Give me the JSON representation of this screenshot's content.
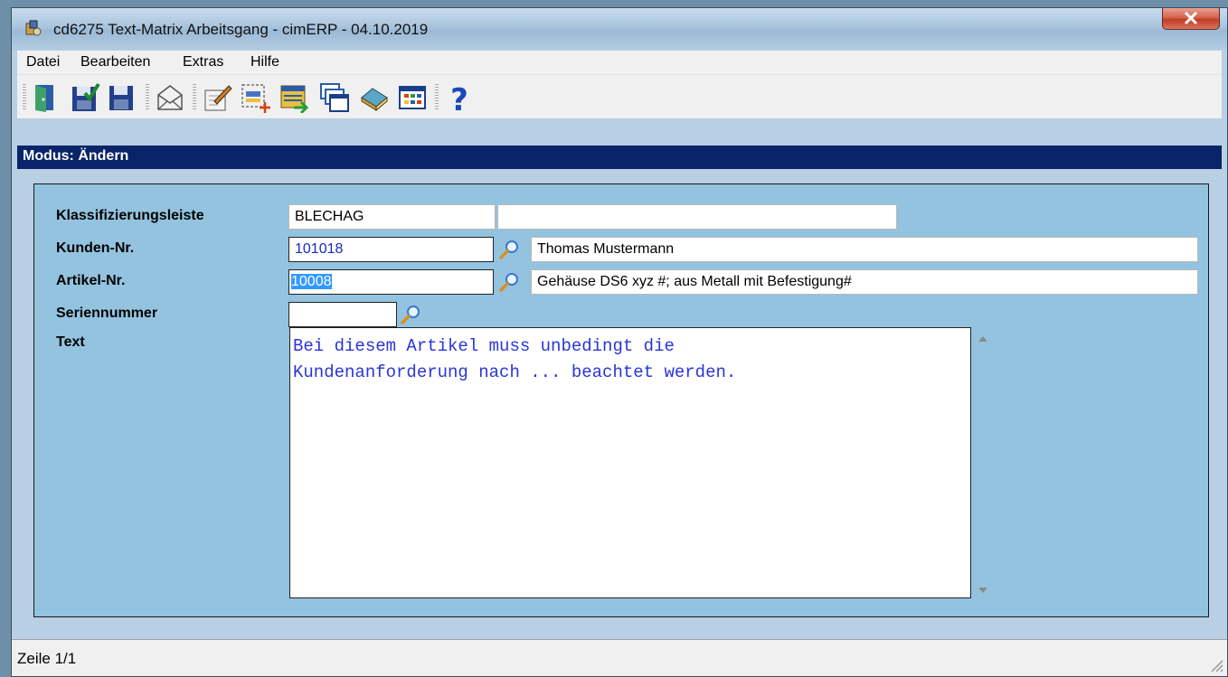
{
  "window": {
    "title": "cd6275 Text-Matrix Arbeitsgang - cimERP - 04.10.2019"
  },
  "menu": [
    "Datei",
    "Bearbeiten",
    "Extras",
    "Hilfe"
  ],
  "toolbar": [
    "exit-door-icon",
    "save-check-icon",
    "save-icon",
    "envelope-icon",
    "edit-form-icon",
    "new-record-icon",
    "list-transfer-icon",
    "windows-icon",
    "book-icon",
    "grid-calendar-icon",
    "help-question-icon"
  ],
  "mode": {
    "label": "Modus: Ändern"
  },
  "form": {
    "klassifizierung": {
      "label": "Klassifizierungsleiste",
      "value": "BLECHAG",
      "value2": ""
    },
    "kunde": {
      "label": "Kunden-Nr.",
      "value": "101018",
      "name": "Thomas Mustermann"
    },
    "artikel": {
      "label": "Artikel-Nr.",
      "value": "10008",
      "name": "Gehäuse DS6 xyz #; aus Metall mit Befestigung#"
    },
    "serie": {
      "label": "Seriennummer",
      "value": ""
    },
    "text": {
      "label": "Text",
      "value": "Bei diesem Artikel muss unbedingt die\nKundenanforderung nach ... beachtet werden."
    }
  },
  "status": {
    "text": "Zeile 1/1"
  },
  "colors": {
    "mode_bar": "#0a246a",
    "panel": "#93c3df",
    "text_blue": "#2a35d8",
    "chrome": "#b8cfe4"
  }
}
